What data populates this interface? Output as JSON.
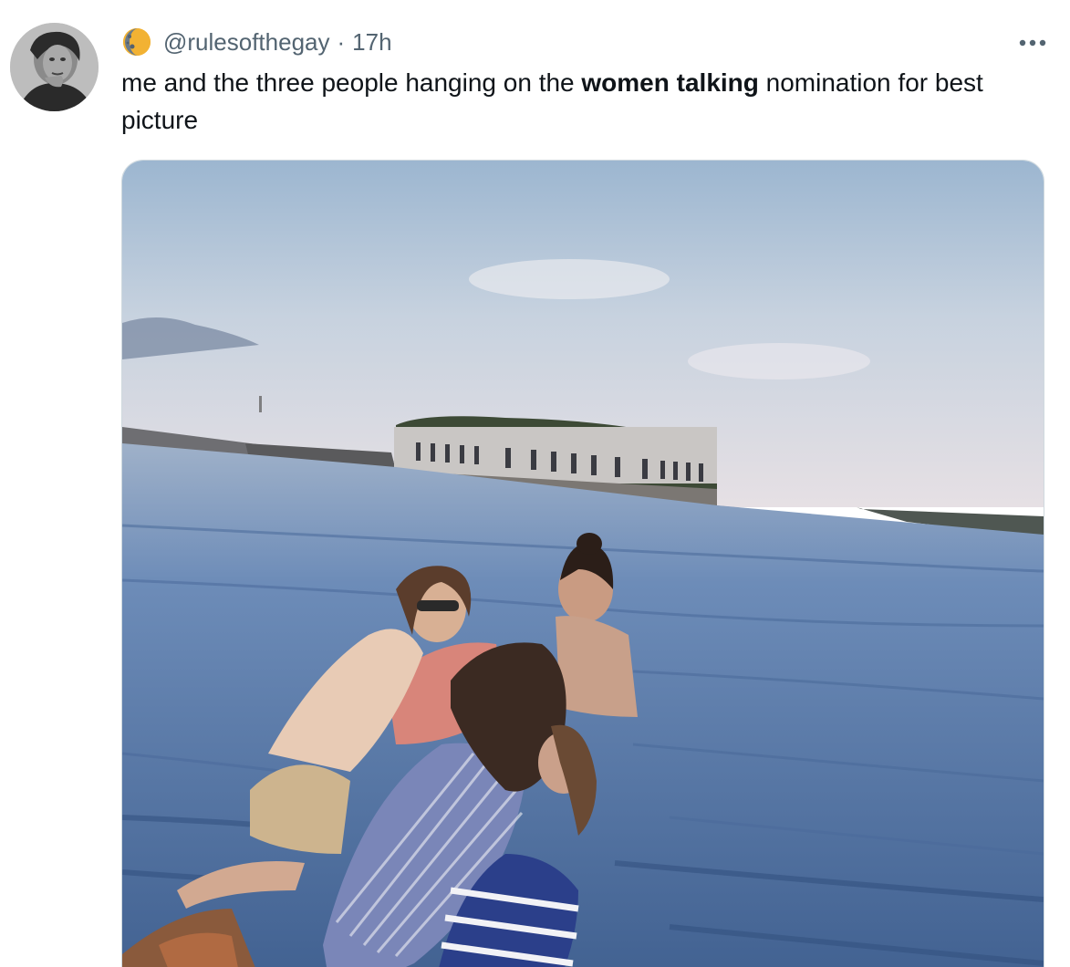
{
  "tweet": {
    "handle": "@rulesofthegay",
    "separator": "·",
    "time": "17h",
    "text_before": "me and the three people hanging on the ",
    "text_bold": "women talking",
    "text_after": " nomination for best picture",
    "more_icon": "more-horizontal-icon",
    "badge_icon": "crescent-moon-icon"
  },
  "colors": {
    "text": "#0f1419",
    "secondary": "#536471",
    "border": "#cfd9de",
    "sky_top": "#9db8d3",
    "sky_bottom": "#e6e3e6",
    "water": "#5d7fae"
  }
}
